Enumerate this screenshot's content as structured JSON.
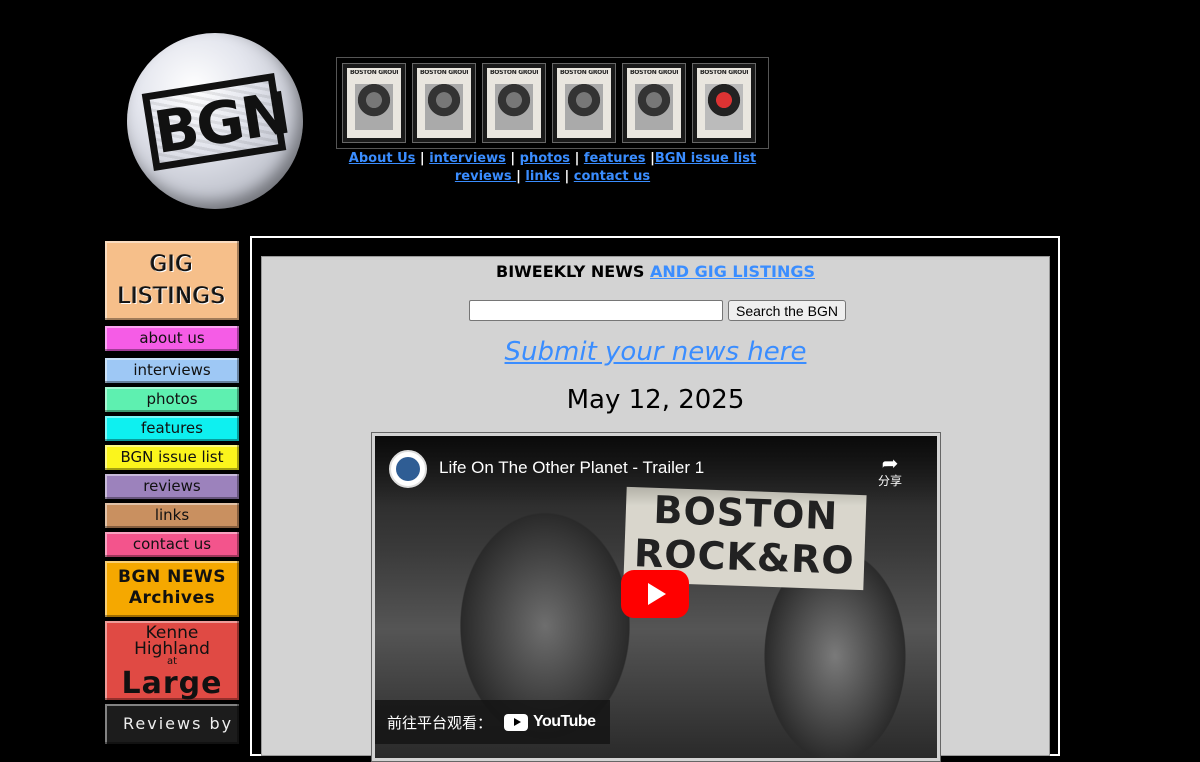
{
  "logo": {
    "text": "BGN"
  },
  "covers": [
    {
      "title": "BOSTON GROUPIE",
      "photo": "portrait"
    },
    {
      "title": "BOSTON GROUPIE",
      "photo": "portrait"
    },
    {
      "title": "BOSTON GROUPIE",
      "photo": "portrait"
    },
    {
      "title": "BOSTON GROUPIE",
      "photo": "portrait"
    },
    {
      "title": "BOSTON GROUPIE",
      "photo": "portrait"
    },
    {
      "title": "BOSTON GROUPIE",
      "photo": "red-portrait"
    }
  ],
  "topnav": {
    "about": "About Us",
    "interviews": "interviews",
    "photos": "photos",
    "features": "features",
    "issue_list": "BGN issue list",
    "reviews": "reviews ",
    "links": "links",
    "contact": "contact us",
    "sep": "|"
  },
  "sidebar": {
    "gig_line1": "GIG",
    "gig_line2": "LISTINGS",
    "about": "about us",
    "interviews": "interviews",
    "photos": "photos",
    "features": "features",
    "issue_list": "BGN issue list",
    "reviews": "reviews",
    "links": "links",
    "contact": "contact us",
    "news_line1": "BGN NEWS",
    "news_line2": "Archives",
    "kenne_line1": "Kenne",
    "kenne_line2": "Highland",
    "kenne_line3": "at",
    "kenne_line4": "Large",
    "reviews_by": "Reviews by"
  },
  "colors": {
    "about": "#f55ce6",
    "interviews": "#9ec8f5",
    "photos": "#5ef0b0",
    "features": "#0ef0f0",
    "issue_list": "#fbf51c",
    "reviews": "#9c82bc",
    "links": "#c99060",
    "contact": "#f3548c"
  },
  "main": {
    "headline_static": "BIWEEKLY NEWS ",
    "headline_link": "AND GIG LISTINGS",
    "search_value": "",
    "search_button": "Search the BGN",
    "submit_link": "Submit your news here",
    "date": "May 12, 2025"
  },
  "video": {
    "title": "Life On The Other Planet - Trailer 1",
    "share_label": "分享",
    "watch_on": "前往平台观看：",
    "youtube": "YouTube",
    "banner_line1": "BOSTON",
    "banner_line2": "ROCK&RO"
  }
}
